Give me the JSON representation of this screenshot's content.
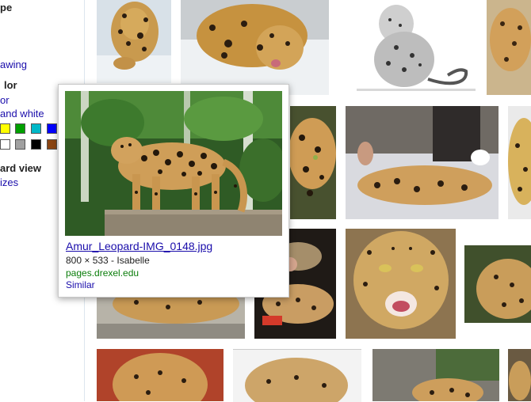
{
  "sidebar": {
    "type_heading": "pe",
    "type_link_drawing": "awing",
    "color_heading": "lor",
    "color_link_full": "or",
    "color_link_bw": "and white",
    "swatches": [
      "#ffff00",
      "#00a000",
      "#00b8c8",
      "#0000ff",
      "#ffffff",
      "#a0a0a0",
      "#000000",
      "#8b4513"
    ],
    "view_heading": "ard view",
    "view_link_sizes": "izes"
  },
  "popup": {
    "title": "Amur_Leopard-IMG_0148.jpg",
    "meta": "800 × 533 - Isabelle",
    "domain": "pages.drexel.edu",
    "similar": "Similar"
  },
  "colors": {
    "link": "#1a0dab",
    "domain_green": "#0a7d0a"
  }
}
